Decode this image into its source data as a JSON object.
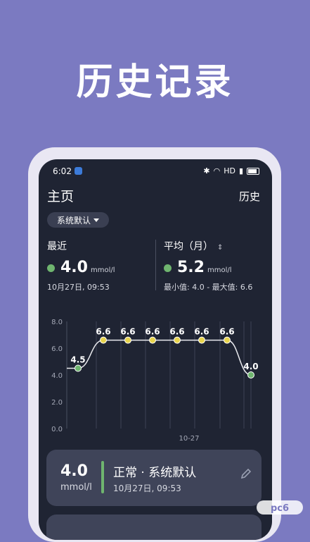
{
  "promo": {
    "title": "历史记录"
  },
  "status_bar": {
    "time": "6:02",
    "network": "HD"
  },
  "nav": {
    "home": "主页",
    "history": "历史"
  },
  "dropdown": {
    "selected": "系统默认"
  },
  "latest": {
    "label": "最近",
    "value": "4.0",
    "unit": "mmol/l",
    "time": "10月27日, 09:53",
    "color": "#6fb56f"
  },
  "average": {
    "label": "平均（月）",
    "value": "5.2",
    "unit": "mmol/l",
    "range": "最小值: 4.0 - 最大值: 6.6"
  },
  "chart_data": {
    "type": "line",
    "y_ticks": [
      "8.0",
      "6.0",
      "4.0",
      "2.0",
      "0.0"
    ],
    "ylim": [
      0,
      8
    ],
    "x_tick": "10-27",
    "points": [
      {
        "label": "4.5",
        "value": 4.5,
        "color": "#6fb56f"
      },
      {
        "label": "6.6",
        "value": 6.6,
        "color": "#e8d44d"
      },
      {
        "label": "6.6",
        "value": 6.6,
        "color": "#e8d44d"
      },
      {
        "label": "6.6",
        "value": 6.6,
        "color": "#e8d44d"
      },
      {
        "label": "6.6",
        "value": 6.6,
        "color": "#e8d44d"
      },
      {
        "label": "6.6",
        "value": 6.6,
        "color": "#e8d44d"
      },
      {
        "label": "6.6",
        "value": 6.6,
        "color": "#e8d44d"
      },
      {
        "label": "4.0",
        "value": 4.0,
        "color": "#6fb56f"
      }
    ]
  },
  "record_card": {
    "value": "4.0",
    "unit": "mmol/l",
    "status": "正常 · 系统默认",
    "time": "10月27日, 09:53"
  },
  "watermark": "pc6"
}
